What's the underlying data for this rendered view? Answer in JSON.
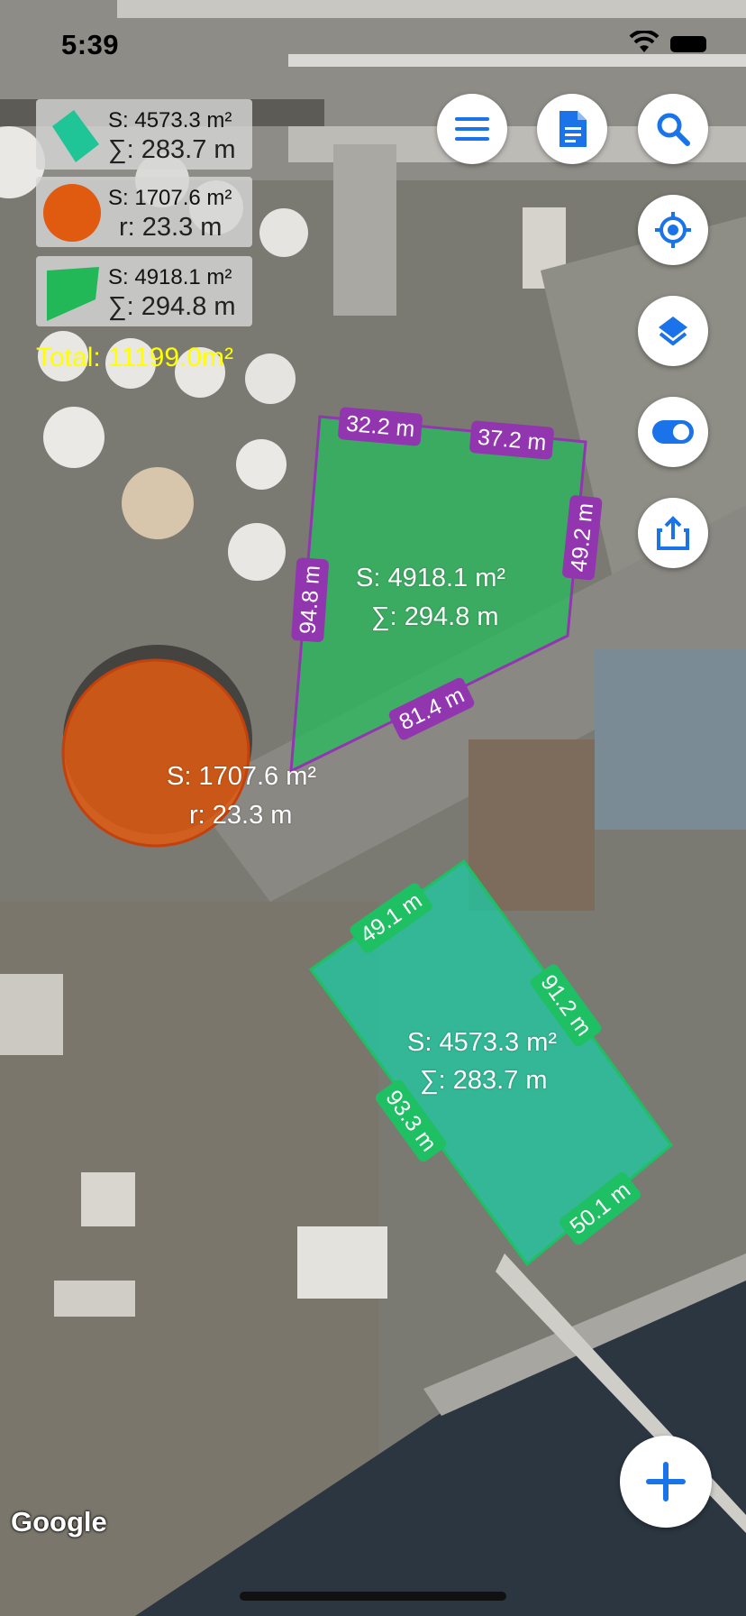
{
  "status_bar": {
    "time": "5:39"
  },
  "legend": [
    {
      "icon": "green-quad-icon",
      "color": "#1fc497",
      "line1": "S: 4573.3 m²",
      "line2": "∑: 283.7 m"
    },
    {
      "icon": "orange-circle-icon",
      "color": "#e05a10",
      "line1": "S: 1707.6 m²",
      "line2": "r: 23.3 m"
    },
    {
      "icon": "green-polygon-icon",
      "color": "#22b858",
      "line1": "S: 4918.1 m²",
      "line2": "∑: 294.8 m"
    }
  ],
  "total": "Total: 11199.0m²",
  "shapes": {
    "polygon_green": {
      "area": "S: 4918.1 m²",
      "perimeter": "∑: 294.8 m",
      "segments": [
        "32.2 m",
        "37.2 m",
        "49.2 m",
        "81.4 m",
        "94.8 m"
      ]
    },
    "circle_orange": {
      "area": "S: 1707.6 m²",
      "radius": "r: 23.3 m"
    },
    "polygon_teal": {
      "area": "S: 4573.3 m²",
      "perimeter": "∑: 283.7 m",
      "segments": [
        "49.1 m",
        "91.2 m",
        "93.3 m",
        "50.1 m"
      ]
    }
  },
  "toolbar": {
    "menu": "menu-icon",
    "documents": "document-icon",
    "search": "search-icon",
    "my_location": "my-location-icon",
    "layers": "layers-icon",
    "toggle": "toggle-icon",
    "share": "share-icon",
    "add": "add-icon"
  },
  "map_attribution": "Google",
  "colors": {
    "accent": "#1a73e8",
    "segment_purple": "#9236b0",
    "segment_green": "#1fbf64",
    "total_text": "#ffff00"
  }
}
